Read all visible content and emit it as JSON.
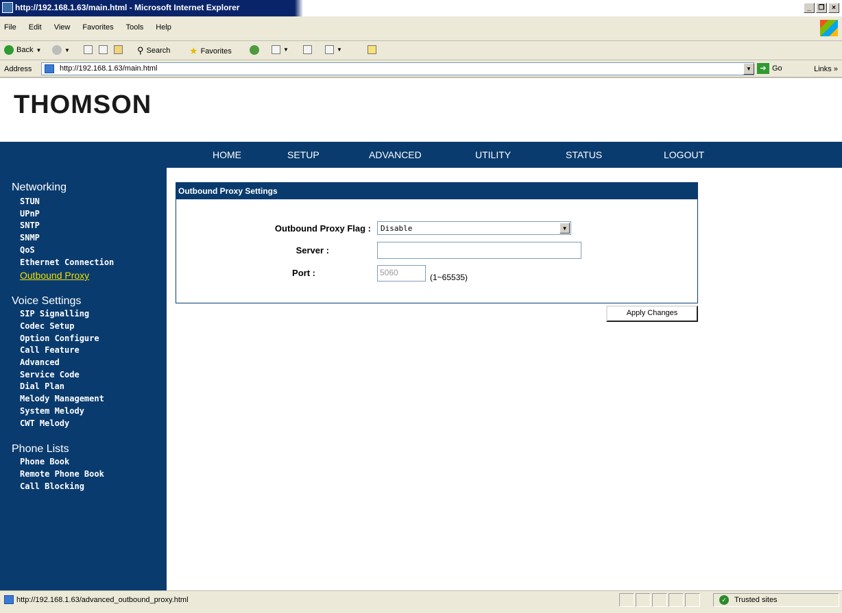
{
  "window": {
    "title": "http://192.168.1.63/main.html - Microsoft Internet Explorer",
    "min_label": "_",
    "max_label": "❐",
    "close_label": "×"
  },
  "menubar": {
    "items": [
      {
        "label": "File"
      },
      {
        "label": "Edit"
      },
      {
        "label": "View"
      },
      {
        "label": "Favorites"
      },
      {
        "label": "Tools"
      },
      {
        "label": "Help"
      }
    ]
  },
  "toolbar": {
    "back_label": "Back",
    "search_label": "Search",
    "favorites_label": "Favorites"
  },
  "address": {
    "label": "Address",
    "url": "http://192.168.1.63/main.html",
    "go_label": "Go",
    "links_label": "Links"
  },
  "page": {
    "brand": "THOMSON",
    "nav": [
      "HOME",
      "SETUP",
      "ADVANCED",
      "UTILITY",
      "STATUS",
      "LOGOUT"
    ],
    "sidebar": {
      "networking": {
        "title": "Networking",
        "items": [
          "STUN",
          "UPnP",
          "SNTP",
          "SNMP",
          "QoS",
          "Ethernet Connection",
          "Outbound Proxy"
        ]
      },
      "voice": {
        "title": "Voice Settings",
        "items": [
          "SIP Signalling",
          "Codec Setup",
          "Option Configure",
          "Call Feature",
          "Advanced",
          "Service Code",
          "Dial Plan",
          "Melody Management",
          "System Melody",
          "CWT Melody"
        ]
      },
      "phone": {
        "title": "Phone Lists",
        "items": [
          "Phone Book",
          "Remote Phone Book",
          "Call Blocking"
        ]
      }
    },
    "panel": {
      "title": "Outbound Proxy Settings",
      "flag_label": "Outbound Proxy Flag :",
      "flag_value": "Disable",
      "server_label": "Server :",
      "server_value": "",
      "port_label": "Port :",
      "port_value": "5060",
      "port_hint": "(1~65535)"
    },
    "apply_label": "Apply Changes"
  },
  "statusbar": {
    "url": "http://192.168.1.63/advanced_outbound_proxy.html",
    "zone": "Trusted sites"
  }
}
